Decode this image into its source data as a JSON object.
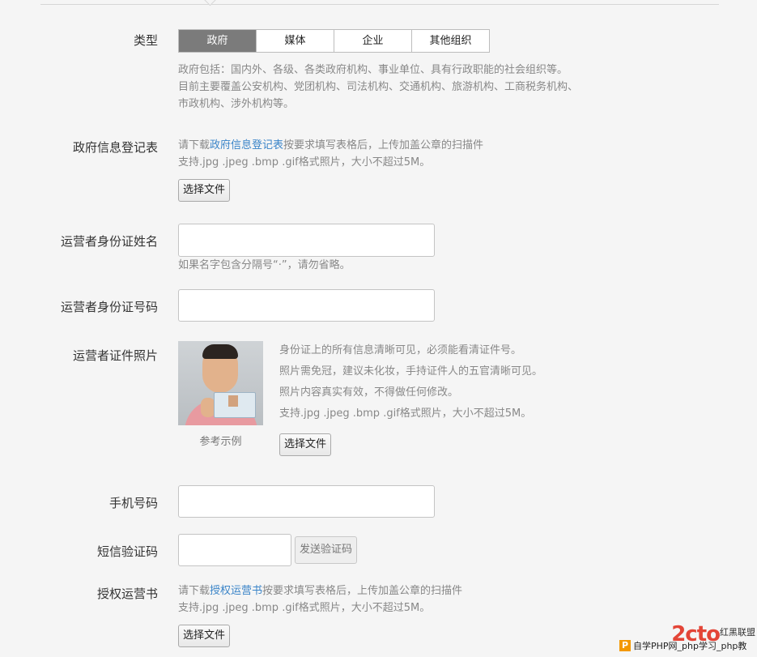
{
  "type_row": {
    "label": "类型",
    "tabs": [
      "政府",
      "媒体",
      "企业",
      "其他组织"
    ],
    "active_tab": 0,
    "desc_lines": [
      "政府包括：国内外、各级、各类政府机构、事业单位、具有行政职能的社会组织等。",
      "目前主要覆盖公安机构、党团机构、司法机构、交通机构、旅游机构、工商税务机构、",
      "市政机构、涉外机构等。"
    ]
  },
  "gov_form": {
    "label": "政府信息登记表",
    "hint_prefix": "请下载",
    "hint_link": "政府信息登记表",
    "hint_suffix": "按要求填写表格后，上传加盖公章的扫描件",
    "formats": "支持.jpg .jpeg .bmp .gif格式照片，大小不超过5M。",
    "button": "选择文件"
  },
  "operator_name": {
    "label": "运营者身份证姓名",
    "value": "",
    "hint": "如果名字包含分隔号“·”，请勿省略。"
  },
  "operator_id": {
    "label": "运营者身份证号码",
    "value": ""
  },
  "operator_photo": {
    "label": "运营者证件照片",
    "caption": "参考示例",
    "notes": [
      "身份证上的所有信息清晰可见，必须能看清证件号。",
      "照片需免冠，建议未化妆，手持证件人的五官清晰可见。",
      "照片内容真实有效，不得做任何修改。",
      "支持.jpg .jpeg .bmp .gif格式照片，大小不超过5M。"
    ],
    "button": "选择文件"
  },
  "phone": {
    "label": "手机号码",
    "value": ""
  },
  "sms": {
    "label": "短信验证码",
    "value": "",
    "send_button": "发送验证码"
  },
  "authorization": {
    "label": "授权运营书",
    "hint_prefix": "请下载",
    "hint_link": "授权运营书",
    "hint_suffix": "按要求填写表格后，上传加盖公章的扫描件",
    "formats": "支持.jpg .jpeg .bmp .gif格式照片，大小不超过5M。",
    "button": "选择文件"
  },
  "watermark": {
    "logo": "2cto",
    "title": "红黑联盟",
    "bar": "自学PHP网_php学习_php教",
    "p_icon": "P"
  },
  "colors": {
    "link": "#3a84c8",
    "active_tab": "#7b7b7b",
    "watermark_red": "#e34537",
    "watermark_orange": "#f39800"
  }
}
